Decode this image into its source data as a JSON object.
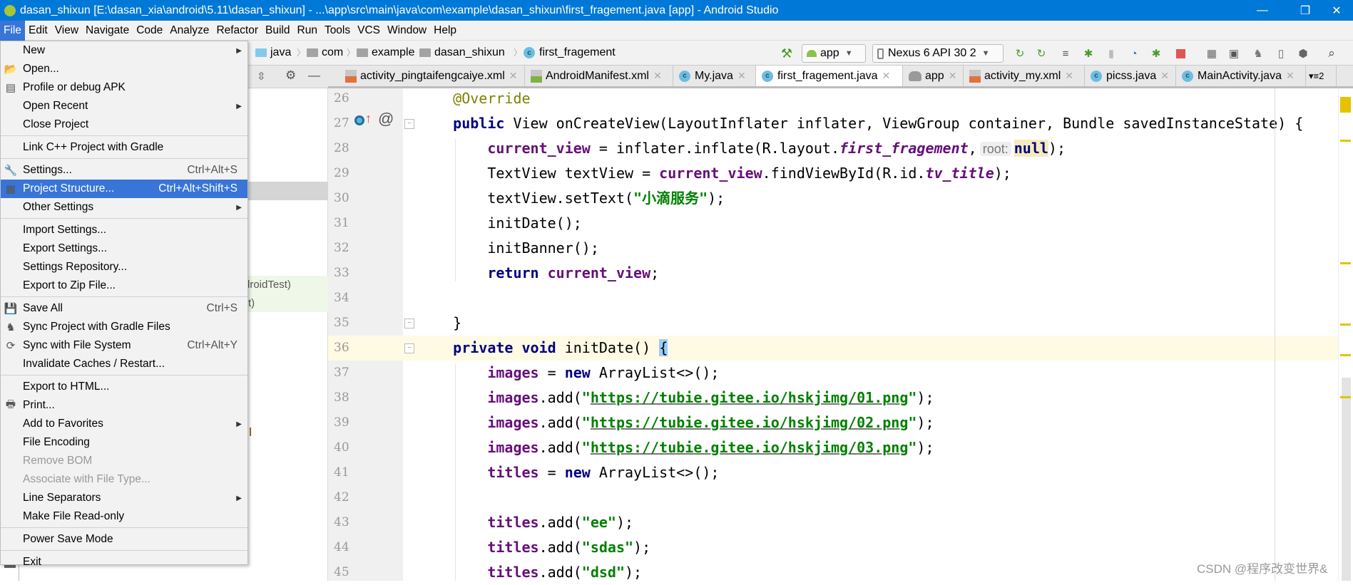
{
  "window": {
    "title": "dasan_shixun [E:\\dasan_xia\\android\\5.11\\dasan_shixun] - ...\\app\\src\\main\\java\\com\\example\\dasan_shixun\\first_fragement.java [app] - Android Studio",
    "minimize": "—",
    "maximize": "❐",
    "close": "✕"
  },
  "menubar": [
    "File",
    "Edit",
    "View",
    "Navigate",
    "Code",
    "Analyze",
    "Refactor",
    "Build",
    "Run",
    "Tools",
    "VCS",
    "Window",
    "Help"
  ],
  "breadcrumb": [
    "java",
    "com",
    "example",
    "dasan_shixun",
    "first_fragement"
  ],
  "toolbar": {
    "config": "app",
    "device": "Nexus 6 API 30 2",
    "icons": [
      "hammer-icon",
      "run-config-dropdown",
      "device-dropdown",
      "apply-changes-icon",
      "apply-code-changes-icon",
      "logcat-icon",
      "debug-icon",
      "profile-icon",
      "profiler-icon",
      "attach-debugger-icon",
      "stop-icon",
      "project-structure-icon",
      "avd-manager-icon",
      "sync-gradle-icon",
      "sdk-manager-icon",
      "resource-manager-icon",
      "search-icon"
    ]
  },
  "tabs": [
    {
      "label": "activity_pingtaifengcaiye.xml",
      "type": "xml"
    },
    {
      "label": "AndroidManifest.xml",
      "type": "mf"
    },
    {
      "label": "My.java",
      "type": "class"
    },
    {
      "label": "first_fragement.java",
      "type": "class",
      "active": true
    },
    {
      "label": "app",
      "type": "gradle"
    },
    {
      "label": "activity_my.xml",
      "type": "xml"
    },
    {
      "label": "picss.java",
      "type": "class"
    },
    {
      "label": "MainActivity.java",
      "type": "class"
    }
  ],
  "tabs_overflow": "▾≡2",
  "left_panel": {
    "row1": "droidTest)",
    "row2": "t)"
  },
  "file_menu": [
    {
      "label": "New",
      "submenu": true
    },
    {
      "label": "Open...",
      "icon": "folder-open-icon"
    },
    {
      "label": "Profile or debug APK",
      "icon": "apk-icon"
    },
    {
      "label": "Open Recent",
      "submenu": true
    },
    {
      "label": "Close Project"
    },
    {
      "sep": true
    },
    {
      "label": "Link C++ Project with Gradle"
    },
    {
      "sep": true
    },
    {
      "label": "Settings...",
      "shortcut": "Ctrl+Alt+S",
      "icon": "wrench-icon"
    },
    {
      "label": "Project Structure...",
      "shortcut": "Ctrl+Alt+Shift+S",
      "icon": "project-structure-icon",
      "highlighted": true
    },
    {
      "label": "Other Settings",
      "submenu": true
    },
    {
      "sep": true
    },
    {
      "label": "Import Settings..."
    },
    {
      "label": "Export Settings..."
    },
    {
      "label": "Settings Repository..."
    },
    {
      "label": "Export to Zip File..."
    },
    {
      "sep": true
    },
    {
      "label": "Save All",
      "shortcut": "Ctrl+S",
      "icon": "save-icon"
    },
    {
      "label": "Sync Project with Gradle Files",
      "icon": "gradle-sync-icon"
    },
    {
      "label": "Sync with File System",
      "shortcut": "Ctrl+Alt+Y",
      "icon": "refresh-icon"
    },
    {
      "label": "Invalidate Caches / Restart..."
    },
    {
      "sep": true
    },
    {
      "label": "Export to HTML..."
    },
    {
      "label": "Print...",
      "icon": "printer-icon"
    },
    {
      "label": "Add to Favorites",
      "submenu": true
    },
    {
      "label": "File Encoding"
    },
    {
      "label": "Remove BOM",
      "disabled": true
    },
    {
      "label": "Associate with File Type...",
      "disabled": true
    },
    {
      "label": "Line Separators",
      "submenu": true
    },
    {
      "label": "Make File Read-only"
    },
    {
      "sep": true
    },
    {
      "label": "Power Save Mode"
    },
    {
      "sep": true
    },
    {
      "label": "Exit"
    }
  ],
  "editor": {
    "current_line": 36,
    "lines": [
      {
        "n": "26",
        "t": [
          [
            "    ",
            ""
          ],
          [
            "@Override",
            "a"
          ]
        ]
      },
      {
        "n": "27",
        "t": [
          [
            "    ",
            ""
          ],
          [
            "public",
            "k"
          ],
          [
            " View onCreateView(LayoutInflater inflater, ViewGroup container, Bundle savedInstanceState) {",
            ""
          ]
        ]
      },
      {
        "n": "28",
        "t": [
          [
            "        ",
            ""
          ],
          [
            "current_view",
            "f"
          ],
          [
            " = inflater.inflate(R.layout.",
            ""
          ],
          [
            "first_fragement",
            "i"
          ],
          [
            ",",
            ""
          ],
          [
            "root:",
            "h"
          ],
          [
            "null",
            "m"
          ],
          [
            ");",
            ""
          ]
        ]
      },
      {
        "n": "29",
        "t": [
          [
            "        TextView textView = ",
            ""
          ],
          [
            "current_view",
            "f"
          ],
          [
            ".findViewById(R.id.",
            ""
          ],
          [
            "tv_title",
            "i"
          ],
          [
            ");",
            ""
          ]
        ]
      },
      {
        "n": "30",
        "t": [
          [
            "        textView.setText(",
            ""
          ],
          [
            "\"小滴服务\"",
            "s"
          ],
          [
            ");",
            ""
          ]
        ]
      },
      {
        "n": "31",
        "t": [
          [
            "        initDate();",
            ""
          ]
        ]
      },
      {
        "n": "32",
        "t": [
          [
            "        initBanner();",
            ""
          ]
        ]
      },
      {
        "n": "33",
        "t": [
          [
            "        ",
            ""
          ],
          [
            "return",
            "k"
          ],
          [
            " ",
            ""
          ],
          [
            "current_view",
            "f"
          ],
          [
            ";",
            ""
          ]
        ]
      },
      {
        "n": "34",
        "t": []
      },
      {
        "n": "35",
        "t": [
          [
            "    }",
            ""
          ]
        ]
      },
      {
        "n": "36",
        "t": [
          [
            "    ",
            ""
          ],
          [
            "private",
            "k"
          ],
          [
            " ",
            ""
          ],
          [
            "void",
            "k"
          ],
          [
            " initDate() ",
            ""
          ],
          [
            "{",
            "b"
          ]
        ]
      },
      {
        "n": "37",
        "t": [
          [
            "        ",
            ""
          ],
          [
            "images",
            "f"
          ],
          [
            " = ",
            ""
          ],
          [
            "new",
            "k"
          ],
          [
            " ArrayList<>();",
            ""
          ]
        ]
      },
      {
        "n": "38",
        "t": [
          [
            "        ",
            ""
          ],
          [
            "images",
            "f"
          ],
          [
            ".add(",
            ""
          ],
          [
            "\"",
            "s"
          ],
          [
            "https://tubie.gitee.io/hskjimg/01.png",
            "u"
          ],
          [
            "\"",
            "s"
          ],
          [
            ");",
            ""
          ]
        ]
      },
      {
        "n": "39",
        "t": [
          [
            "        ",
            ""
          ],
          [
            "images",
            "f"
          ],
          [
            ".add(",
            ""
          ],
          [
            "\"",
            "s"
          ],
          [
            "https://tubie.gitee.io/hskjimg/02.png",
            "u"
          ],
          [
            "\"",
            "s"
          ],
          [
            ");",
            ""
          ]
        ]
      },
      {
        "n": "40",
        "t": [
          [
            "        ",
            ""
          ],
          [
            "images",
            "f"
          ],
          [
            ".add(",
            ""
          ],
          [
            "\"",
            "s"
          ],
          [
            "https://tubie.gitee.io/hskjimg/03.png",
            "u"
          ],
          [
            "\"",
            "s"
          ],
          [
            ");",
            ""
          ]
        ]
      },
      {
        "n": "41",
        "t": [
          [
            "        ",
            ""
          ],
          [
            "titles",
            "f"
          ],
          [
            " = ",
            ""
          ],
          [
            "new",
            "k"
          ],
          [
            " ArrayList<>();",
            ""
          ]
        ]
      },
      {
        "n": "42",
        "t": []
      },
      {
        "n": "43",
        "t": [
          [
            "        ",
            ""
          ],
          [
            "titles",
            "f"
          ],
          [
            ".add(",
            ""
          ],
          [
            "\"ee\"",
            "s"
          ],
          [
            ");",
            ""
          ]
        ]
      },
      {
        "n": "44",
        "t": [
          [
            "        ",
            ""
          ],
          [
            "titles",
            "f"
          ],
          [
            ".add(",
            ""
          ],
          [
            "\"sdas\"",
            "s"
          ],
          [
            ");",
            ""
          ]
        ]
      },
      {
        "n": "45",
        "t": [
          [
            "        ",
            ""
          ],
          [
            "titles",
            "f"
          ],
          [
            ".add(",
            ""
          ],
          [
            "\"dsd\"",
            "s"
          ],
          [
            ");",
            ""
          ]
        ]
      }
    ]
  },
  "watermark": "CSDN @程序改变世界&",
  "colors": {
    "titlebar": "#0078d7",
    "menu_highlight": "#3875d7",
    "keyword": "#000080",
    "field": "#660e7a",
    "string": "#008000",
    "annotation": "#808000",
    "current_line": "#fffae3"
  }
}
